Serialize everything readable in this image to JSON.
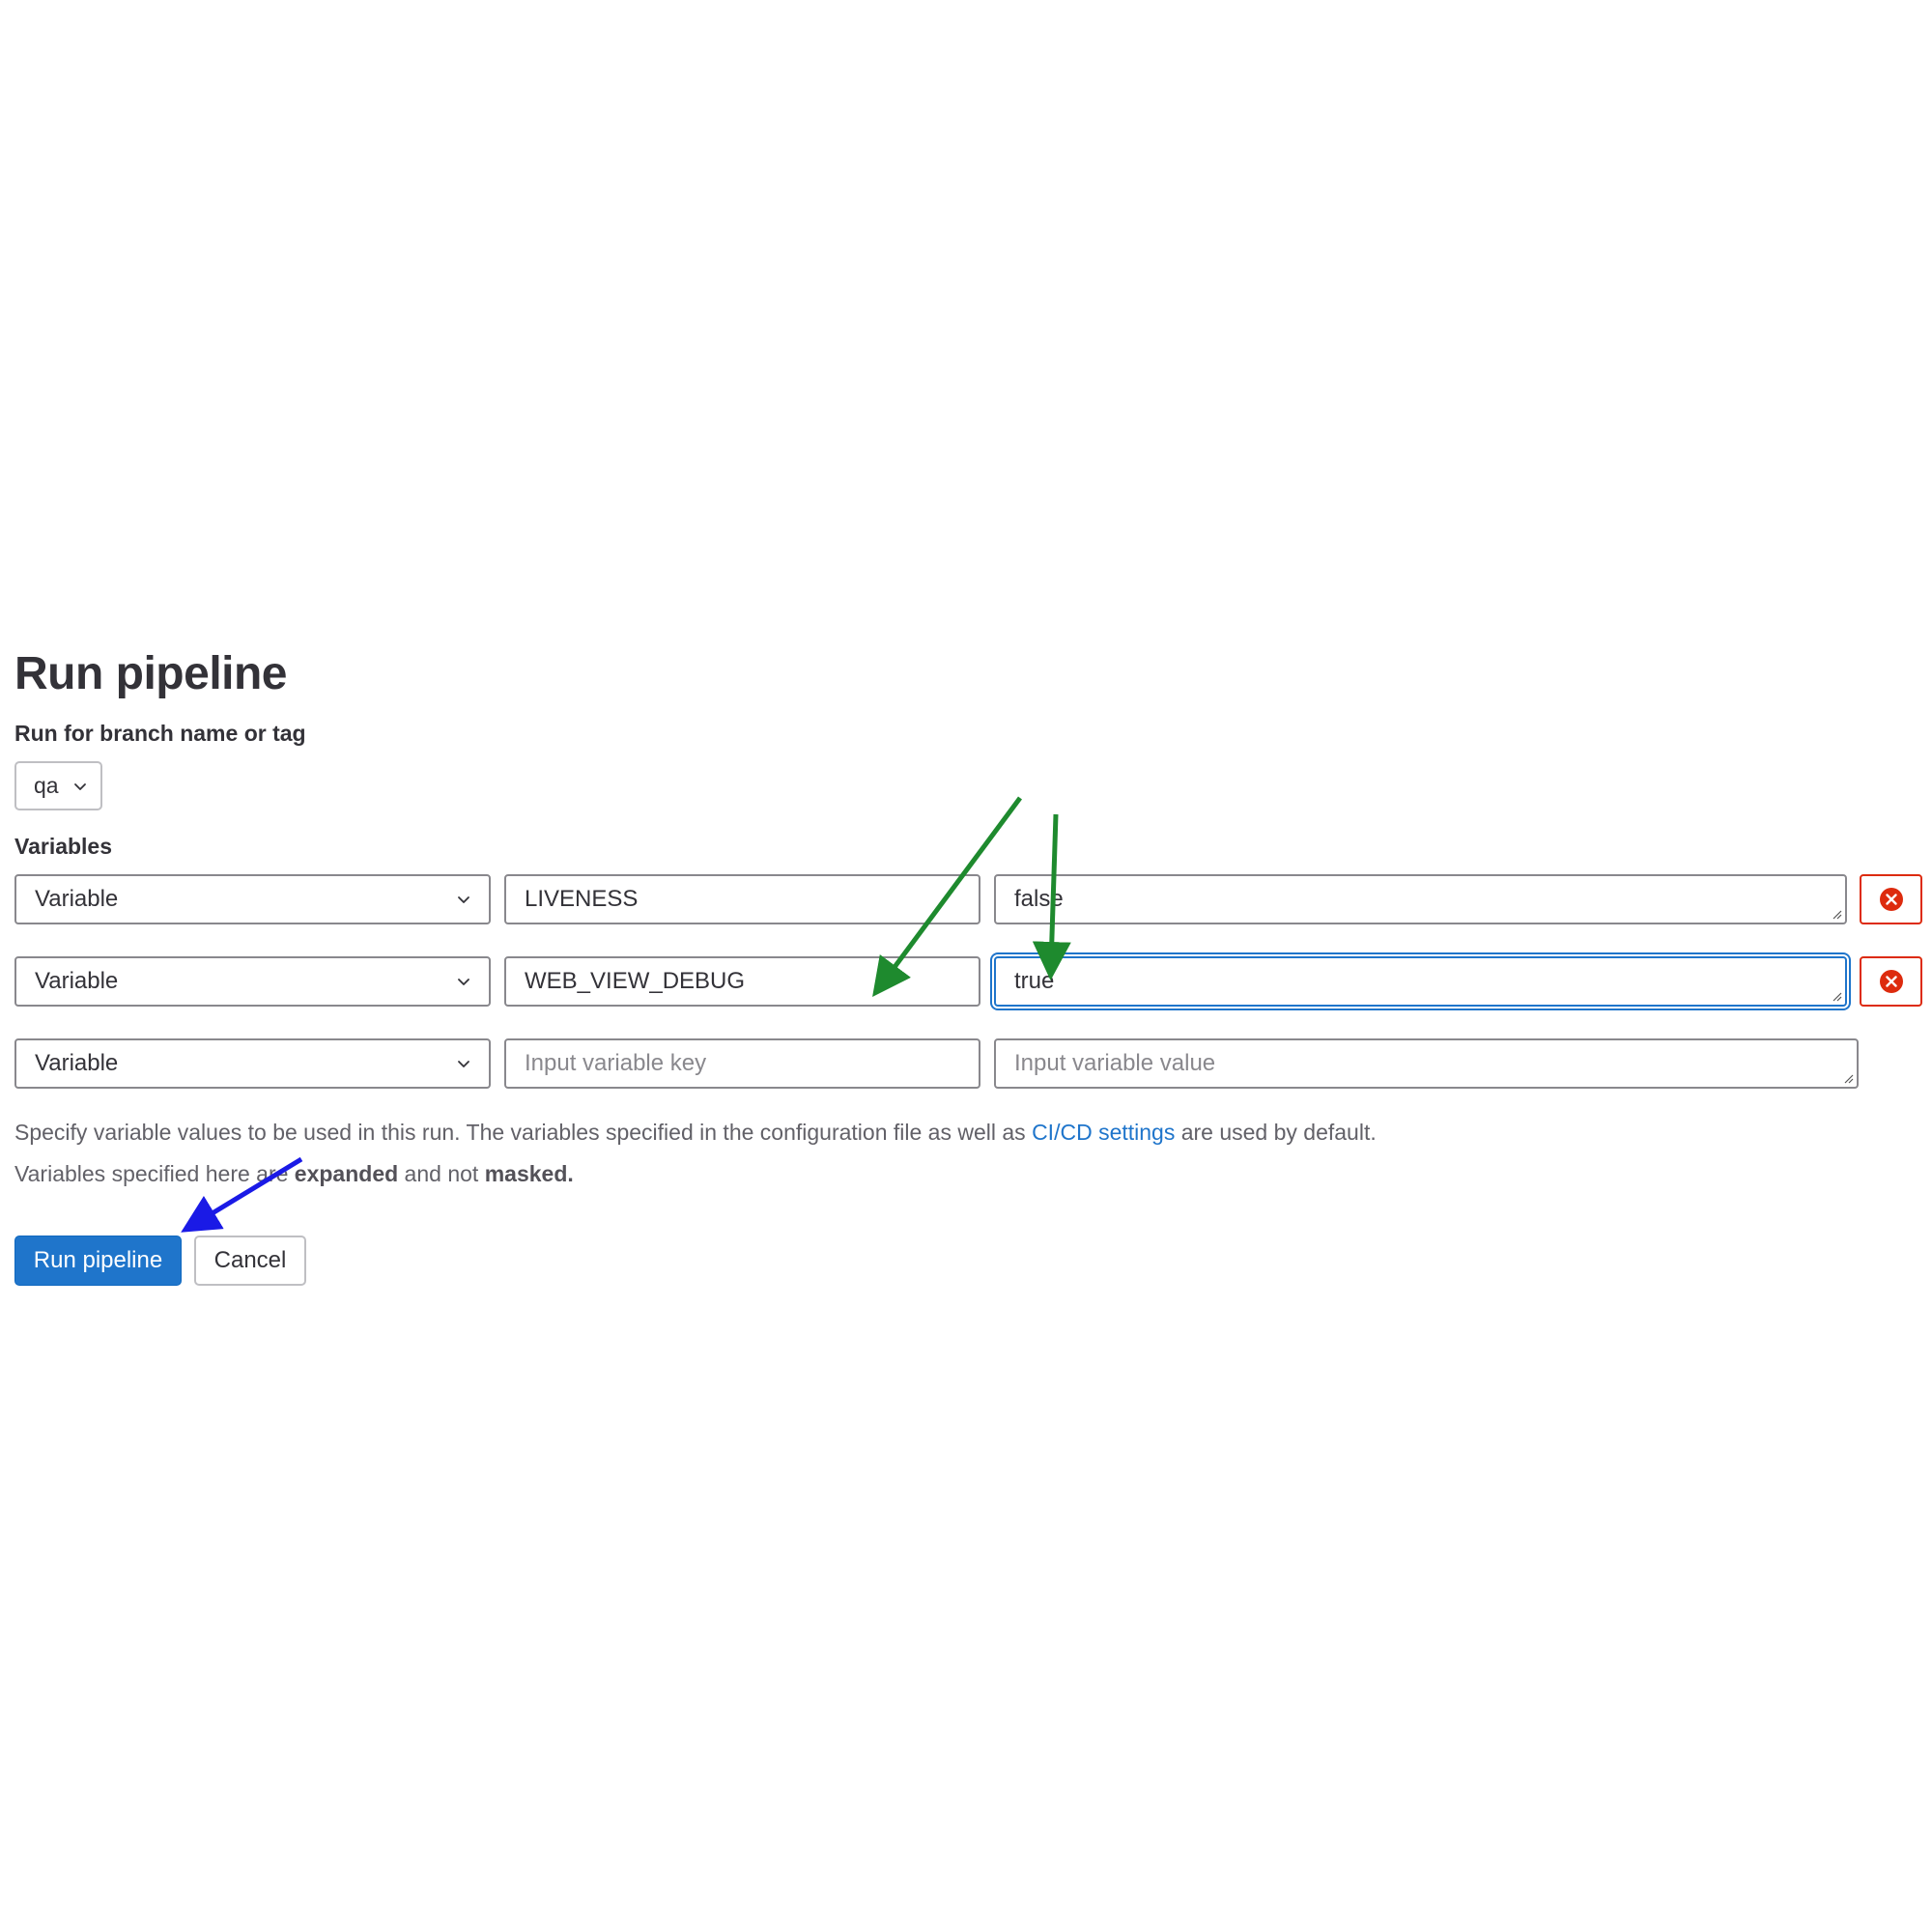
{
  "page": {
    "title": "Run pipeline"
  },
  "branch": {
    "label": "Run for branch name or tag",
    "selected": "qa"
  },
  "variables": {
    "label": "Variables",
    "rows": [
      {
        "type": "Variable",
        "key": "LIVENESS",
        "value": "false"
      },
      {
        "type": "Variable",
        "key": "WEB_VIEW_DEBUG",
        "value": "true"
      },
      {
        "type": "Variable",
        "key_placeholder": "Input variable key",
        "value_placeholder": "Input variable value"
      }
    ]
  },
  "help": {
    "line1_prefix": "Specify variable values to be used in this run. The variables specified in the configuration file as well as ",
    "line1_link": "CI/CD settings",
    "line1_suffix": " are used by default.",
    "line2_prefix": "Variables specified here are ",
    "line2_bold1": "expanded",
    "line2_middle": " and not ",
    "line2_bold2": "masked."
  },
  "actions": {
    "run_label": "Run pipeline",
    "cancel_label": "Cancel"
  },
  "icons": {
    "dropdown": "chevron-down-icon",
    "remove": "close-circle-icon",
    "annotation_arrows": "arrow-annotation"
  },
  "colors": {
    "primary": "#1f75cb",
    "danger": "#dd2b0e",
    "text": "#333238",
    "muted": "#626168",
    "annotation_green": "#1e8a2e",
    "annotation_blue": "#1a1ae6"
  }
}
